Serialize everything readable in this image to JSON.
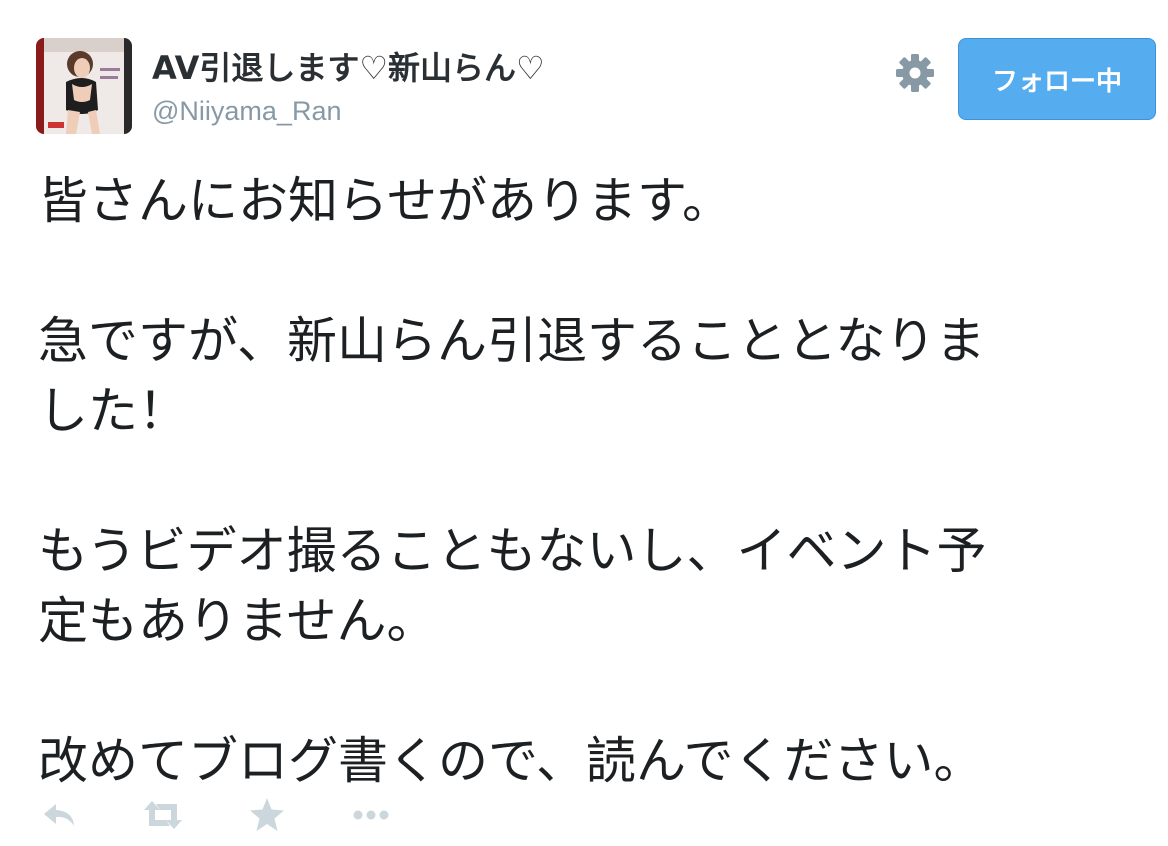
{
  "author": {
    "display_name": "AV引退します♡新山らん♡",
    "username": "@Niiyama_Ran",
    "avatar_icon": "profile-photo"
  },
  "header": {
    "settings_icon": "gear-icon",
    "follow_button_label": "フォロー中"
  },
  "tweet": {
    "paragraphs": [
      {
        "lines": [
          "皆さんにお知らせがあります。"
        ]
      },
      {
        "lines": [
          "急ですが、新山らん引退することとなりま",
          "した！"
        ]
      },
      {
        "lines": [
          "もうビデオ撮ることもないし、イベント予",
          "定もありません。"
        ]
      },
      {
        "lines": [
          "改めてブログ書くので、読んでください。"
        ]
      }
    ]
  },
  "actions": [
    {
      "name": "reply-icon"
    },
    {
      "name": "retweet-icon"
    },
    {
      "name": "favorite-star-icon"
    },
    {
      "name": "more-icon"
    }
  ],
  "colors": {
    "follow_button_bg": "#55acee",
    "icon_gray": "#8899a6",
    "action_icon": "#ccd6dd",
    "text": "#1c2022"
  }
}
